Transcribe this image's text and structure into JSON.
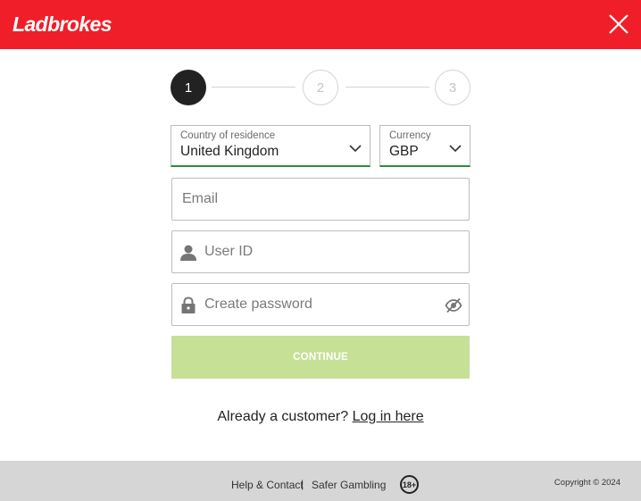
{
  "header": {
    "logo_text": "Ladbrokes",
    "brand_color": "#f01e28",
    "close_icon": "close-icon"
  },
  "steps": {
    "items": [
      {
        "label": "1",
        "state": "active"
      },
      {
        "label": "2",
        "state": "inactive"
      },
      {
        "label": "3",
        "state": "inactive"
      }
    ]
  },
  "form": {
    "country": {
      "label": "Country of residence",
      "value": "United Kingdom",
      "icon": "chevron-down-icon"
    },
    "currency": {
      "label": "Currency",
      "value": "GBP",
      "icon": "chevron-down-icon"
    },
    "email": {
      "placeholder": "Email",
      "value": ""
    },
    "user_id": {
      "placeholder": "User ID",
      "value": "",
      "icon": "user-icon"
    },
    "password": {
      "placeholder": "Create password",
      "value": "",
      "icon": "lock-icon",
      "toggle_icon": "eye-slash-icon"
    },
    "continue_label": "CONTINUE",
    "continue_color": "#c6e096",
    "accent_color": "#2e8b3e"
  },
  "login_prompt": {
    "text": "Already a customer?",
    "link": "Log in here"
  },
  "footer": {
    "help": "Help & Contact",
    "separator": "|",
    "safer_gambling": "Safer Gambling",
    "age_badge": "18+",
    "copyright": "Copyright © 2024"
  }
}
